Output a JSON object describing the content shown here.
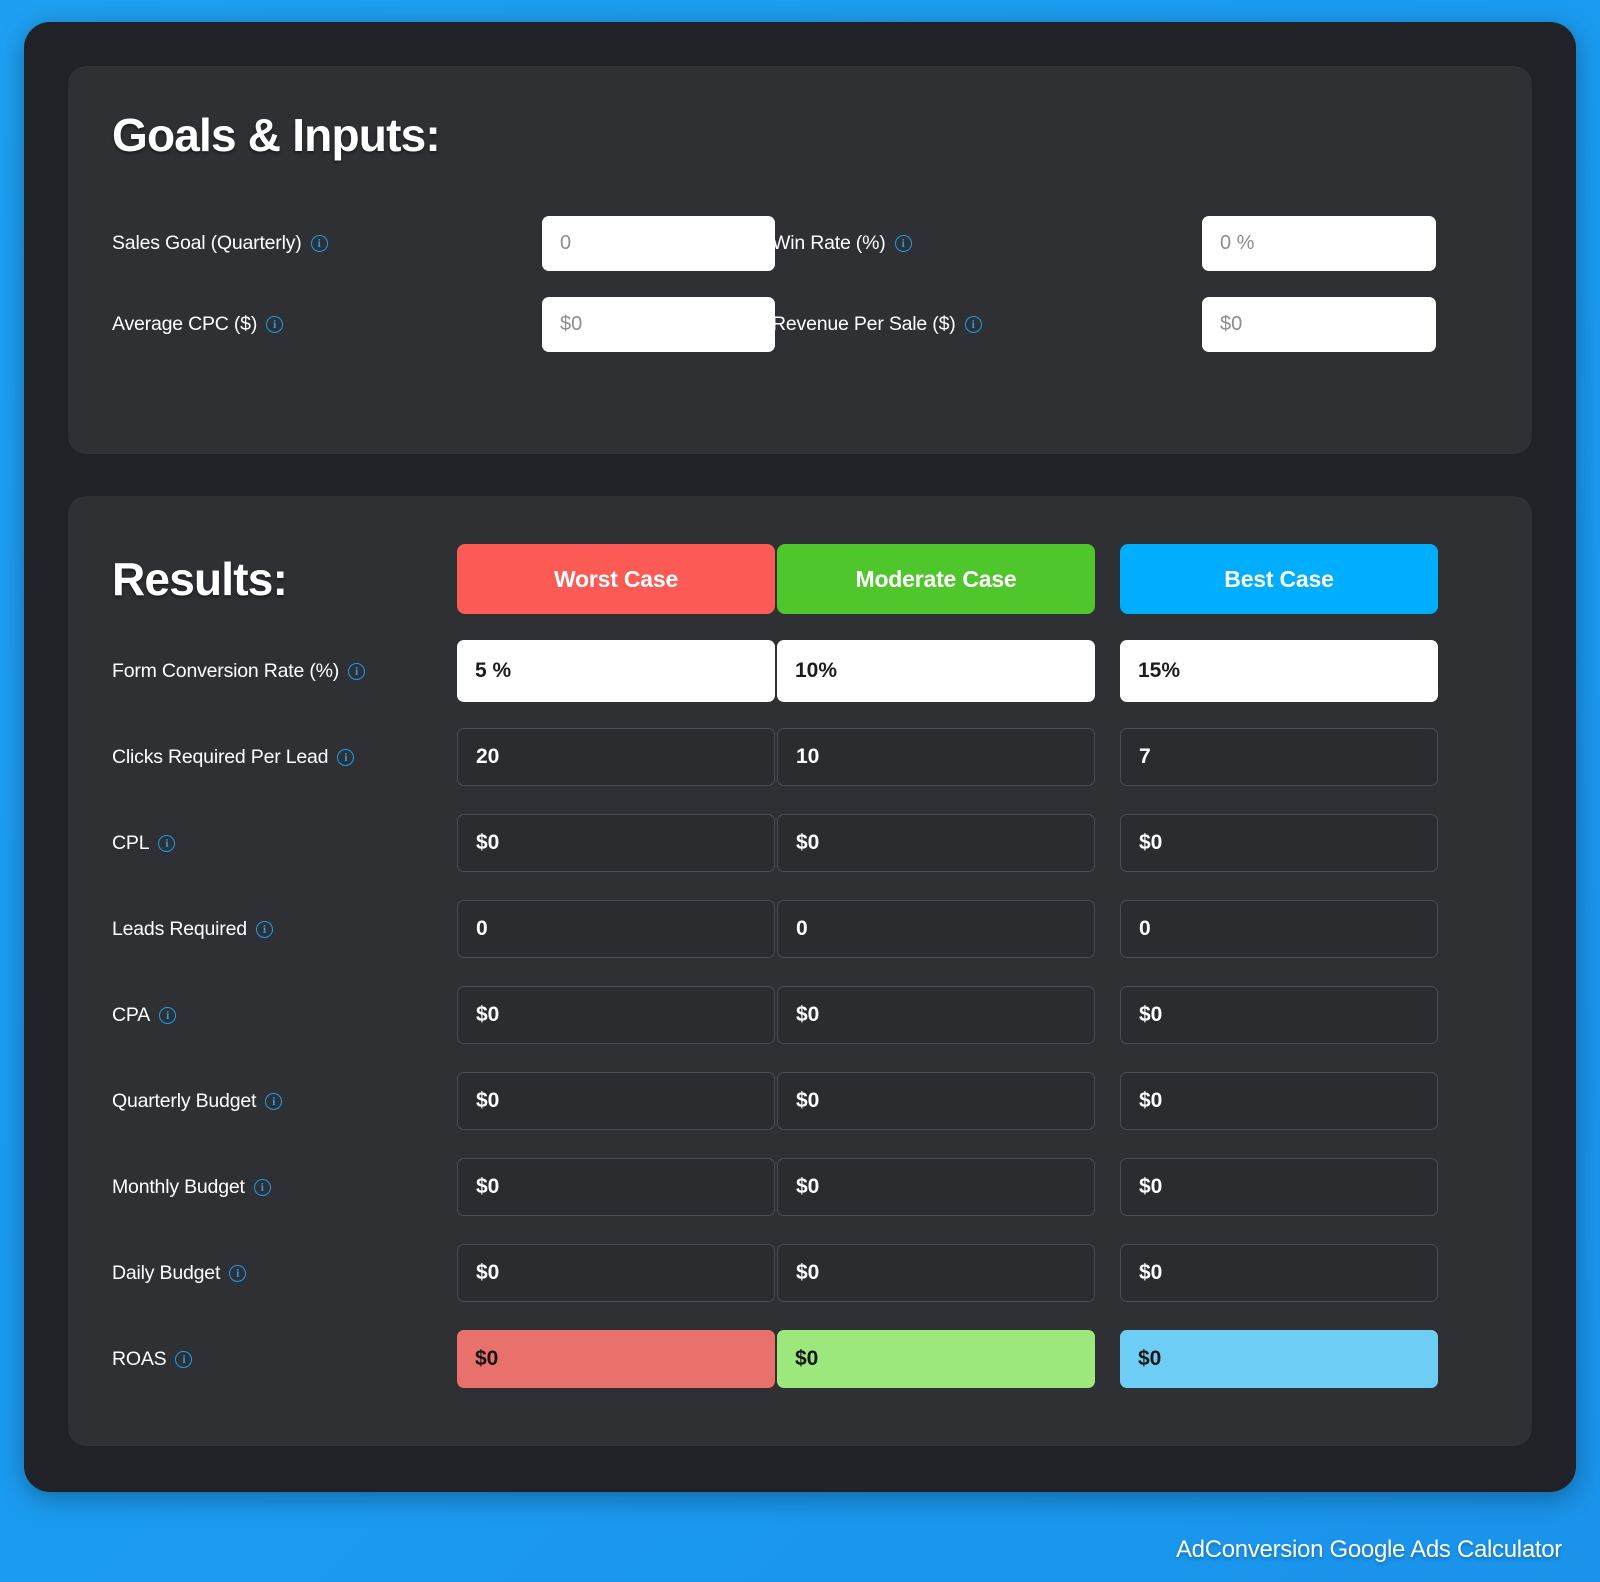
{
  "theme": {
    "page_bg": "#1b9cf0",
    "shell_bg": "#212227",
    "card_bg": "#2f3033",
    "accent": "#1b9cf0",
    "worst": "#fb5a55",
    "moderate": "#4fc62c",
    "best": "#00aeff",
    "roas_worst": "#e8716c",
    "roas_moderate": "#9ce87c",
    "roas_best": "#6ecdf5"
  },
  "inputs_card": {
    "title": "Goals & Inputs:",
    "info_glyph": "i",
    "fields": [
      {
        "label": "Sales Goal (Quarterly)",
        "value": "0"
      },
      {
        "label": "Win Rate (%)",
        "value": "0 %"
      },
      {
        "label": "Average CPC ($)",
        "value": "$0"
      },
      {
        "label": "Revenue Per Sale ($)",
        "value": "$0"
      }
    ]
  },
  "results_card": {
    "title": "Results:",
    "cases": [
      {
        "label": "Worst Case"
      },
      {
        "label": "Moderate Case"
      },
      {
        "label": "Best Case"
      }
    ],
    "rows": [
      {
        "label": "Form Conversion Rate (%)",
        "worst": "5  %",
        "moderate": "10%",
        "best": "15%",
        "kind": "editable"
      },
      {
        "label": "Clicks Required Per Lead",
        "worst": "20",
        "moderate": "10",
        "best": "7",
        "kind": "readonly"
      },
      {
        "label": "CPL",
        "worst": "$0",
        "moderate": "$0",
        "best": "$0",
        "kind": "readonly"
      },
      {
        "label": "Leads Required",
        "worst": "0",
        "moderate": "0",
        "best": "0",
        "kind": "readonly"
      },
      {
        "label": "CPA",
        "worst": "$0",
        "moderate": "$0",
        "best": "$0",
        "kind": "readonly"
      },
      {
        "label": "Quarterly Budget",
        "worst": "$0",
        "moderate": "$0",
        "best": "$0",
        "kind": "readonly"
      },
      {
        "label": "Monthly Budget",
        "worst": "$0",
        "moderate": "$0",
        "best": "$0",
        "kind": "readonly"
      },
      {
        "label": "Daily Budget",
        "worst": "$0",
        "moderate": "$0",
        "best": "$0",
        "kind": "readonly"
      },
      {
        "label": "ROAS",
        "worst": "$0",
        "moderate": "$0",
        "best": "$0",
        "kind": "roas"
      }
    ]
  },
  "footer": {
    "text": "AdConversion Google Ads Calculator"
  }
}
